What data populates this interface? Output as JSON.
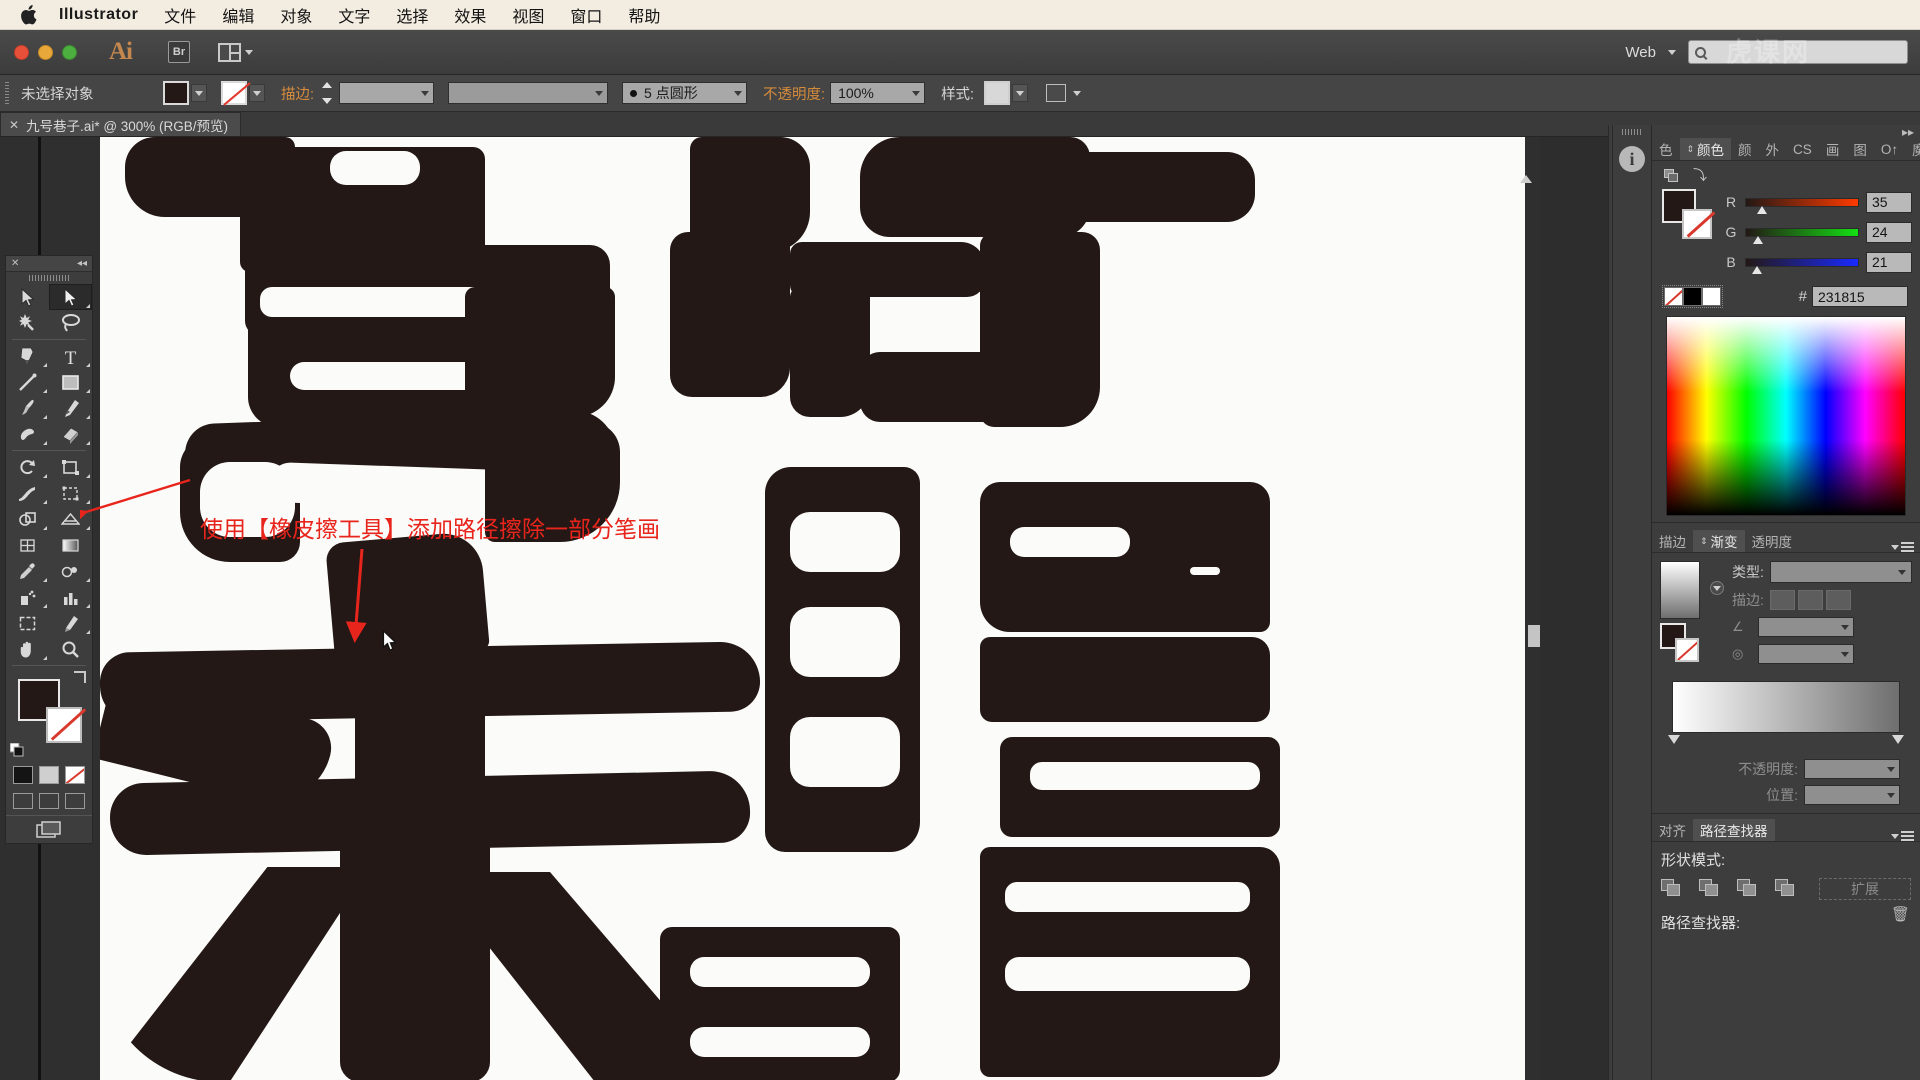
{
  "menubar": {
    "apple_icon": "apple-logo",
    "app_name": "Illustrator",
    "items": [
      "文件",
      "编辑",
      "对象",
      "文字",
      "选择",
      "效果",
      "视图",
      "窗口",
      "帮助"
    ]
  },
  "titlebar": {
    "app_badge": "Ai",
    "bridge_label": "Br",
    "arrange_label": "arrange-documents-icon",
    "workspace": "Web",
    "search_placeholder": "",
    "watermark": "虎课网"
  },
  "controlbar": {
    "selection_status": "未选择对象",
    "fill_color": "#231815",
    "stroke_none": true,
    "stroke_label": "描边:",
    "stroke_weight": "",
    "brush_label": "5 点圆形",
    "opacity_label": "不透明度:",
    "opacity_value": "100%",
    "style_label": "样式:",
    "doc_setup_icon": "document-setup-icon"
  },
  "tabbar": {
    "close_icon": "✕",
    "document_title": "九号巷子.ai* @ 300% (RGB/预览)"
  },
  "toolbar": {
    "tools": [
      {
        "name": "selection-tool",
        "glyph": "arrow-black"
      },
      {
        "name": "direct-selection-tool",
        "glyph": "arrow-white",
        "selected": true
      },
      {
        "name": "magic-wand-tool",
        "glyph": "wand"
      },
      {
        "name": "lasso-tool",
        "glyph": "lasso"
      },
      {
        "name": "pen-tool",
        "glyph": "pen"
      },
      {
        "name": "type-tool",
        "glyph": "T"
      },
      {
        "name": "line-segment-tool",
        "glyph": "line"
      },
      {
        "name": "rectangle-tool",
        "glyph": "rect"
      },
      {
        "name": "paintbrush-tool",
        "glyph": "brush"
      },
      {
        "name": "pencil-tool",
        "glyph": "pencil"
      },
      {
        "name": "blob-brush-tool",
        "glyph": "blob"
      },
      {
        "name": "eraser-tool",
        "glyph": "eraser"
      },
      {
        "name": "rotate-tool",
        "glyph": "rotate"
      },
      {
        "name": "scale-tool",
        "glyph": "scale"
      },
      {
        "name": "width-tool",
        "glyph": "width"
      },
      {
        "name": "free-transform-tool",
        "glyph": "transform"
      },
      {
        "name": "shape-builder-tool",
        "glyph": "shapebuilder"
      },
      {
        "name": "perspective-grid-tool",
        "glyph": "perspective"
      },
      {
        "name": "mesh-tool",
        "glyph": "mesh"
      },
      {
        "name": "gradient-tool",
        "glyph": "gradient"
      },
      {
        "name": "eyedropper-tool",
        "glyph": "eyedropper"
      },
      {
        "name": "blend-tool",
        "glyph": "blend"
      },
      {
        "name": "symbol-sprayer-tool",
        "glyph": "symbol"
      },
      {
        "name": "column-graph-tool",
        "glyph": "graph"
      },
      {
        "name": "artboard-tool",
        "glyph": "artboard"
      },
      {
        "name": "slice-tool",
        "glyph": "slice"
      },
      {
        "name": "hand-tool",
        "glyph": "hand"
      },
      {
        "name": "zoom-tool",
        "glyph": "zoom"
      }
    ],
    "fill_color": "#231815",
    "stroke_color": "none",
    "draw_modes": [
      "draw-normal",
      "draw-behind",
      "draw-inside"
    ],
    "screen_modes": [
      "screen-mode-normal",
      "screen-mode-full-menu",
      "screen-mode-full"
    ]
  },
  "color_panel": {
    "tabs": [
      {
        "label": "色",
        "active": false
      },
      {
        "label": "颜色",
        "active": true
      },
      {
        "label": "颜",
        "active": false
      },
      {
        "label": "外",
        "active": false
      },
      {
        "label": "CS",
        "active": false
      },
      {
        "label": "画",
        "active": false
      },
      {
        "label": "图",
        "active": false
      },
      {
        "label": "O↑",
        "active": false
      },
      {
        "label": "魔棒",
        "active": false
      }
    ],
    "channels": [
      {
        "label": "R",
        "value": "35",
        "pct": 13.7
      },
      {
        "label": "G",
        "value": "24",
        "pct": 9.4
      },
      {
        "label": "B",
        "value": "21",
        "pct": 8.2
      }
    ],
    "hex_label": "#",
    "hex_value": "231815",
    "fill_color": "#231815"
  },
  "gradient_panel": {
    "tabs": [
      {
        "label": "描边",
        "active": false
      },
      {
        "label": "渐变",
        "active": true
      },
      {
        "label": "透明度",
        "active": false
      }
    ],
    "type_label": "类型:",
    "type_value": "",
    "stroke_label": "描边:",
    "angle_value": "",
    "aspect_value": "",
    "opacity_label": "不透明度:",
    "opacity_value": "",
    "position_label": "位置:",
    "position_value": ""
  },
  "pathfinder_panel": {
    "tabs": [
      {
        "label": "对齐",
        "active": false
      },
      {
        "label": "路径查找器",
        "active": true
      }
    ],
    "shape_modes_label": "形状模式:",
    "expand_label": "扩展",
    "pathfinders_label": "路径查找器:"
  },
  "annotations": {
    "instruction": "使用【橡皮擦工具】添加路径擦除一部分笔画",
    "color": "#e8251c"
  },
  "canvas": {
    "artwork_color": "#231815",
    "background_color": "#fbfbf9",
    "zoom": "300%"
  }
}
